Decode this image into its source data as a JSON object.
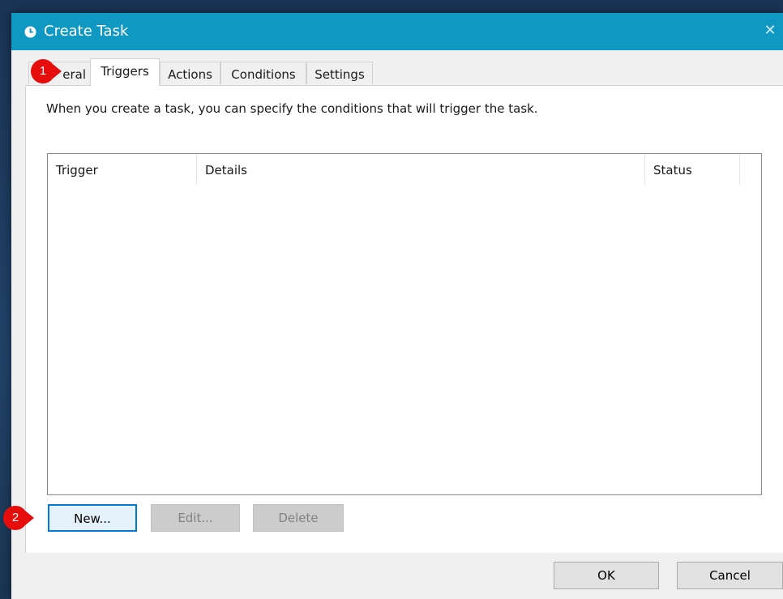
{
  "window": {
    "title": "Create Task",
    "close_glyph": "✕"
  },
  "tabs": [
    {
      "label": "eral",
      "active": false
    },
    {
      "label": "Triggers",
      "active": true
    },
    {
      "label": "Actions",
      "active": false
    },
    {
      "label": "Conditions",
      "active": false
    },
    {
      "label": "Settings",
      "active": false
    }
  ],
  "triggers_panel": {
    "description": "When you create a task, you can specify the conditions that will trigger the task.",
    "columns": [
      "Trigger",
      "Details",
      "Status"
    ],
    "rows": []
  },
  "buttons": {
    "new_label": "New...",
    "edit_label": "Edit...",
    "delete_label": "Delete",
    "ok_label": "OK",
    "cancel_label": "Cancel"
  },
  "annotations": [
    {
      "number": "1",
      "color": "#e60d0d"
    },
    {
      "number": "2",
      "color": "#e60d0d"
    }
  ],
  "colors": {
    "titlebar": "#0f98c2",
    "focus_border": "#0078d7",
    "marker": "#e60d0d"
  },
  "icons": {
    "title": "clock-icon",
    "close": "close-icon"
  }
}
